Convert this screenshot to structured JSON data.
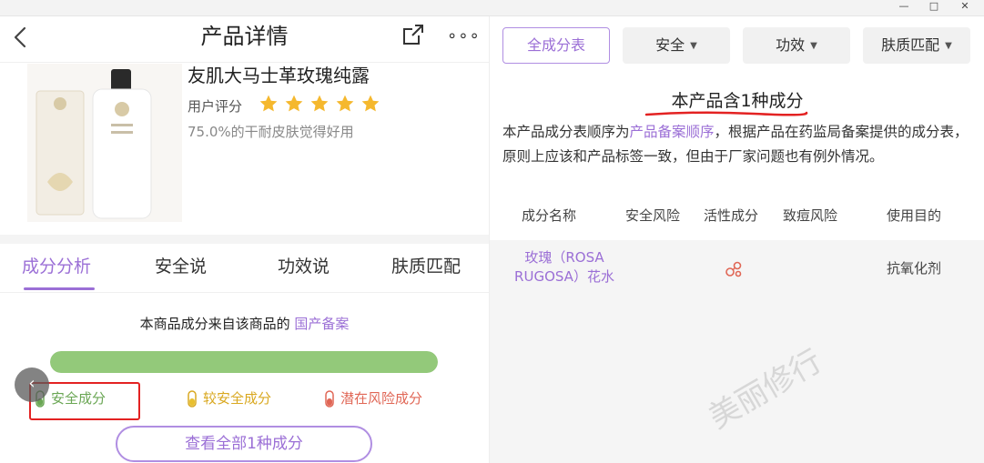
{
  "window": {
    "controls": [
      "minimize-icon",
      "maximize-icon",
      "close-icon"
    ],
    "minimize": "—",
    "maximize": "□",
    "close": "✕"
  },
  "header": {
    "title": "产品详情",
    "back_icon": "chevron-left-icon",
    "share_icon": "share-icon",
    "more": "∘∘∘"
  },
  "product": {
    "name": "友肌大马士革玫瑰纯露",
    "rating_label": "用户评分",
    "stars": 5,
    "star_color": "#f5b82e",
    "dry_skin_stat": "75.0%的干耐皮肤觉得好用"
  },
  "tabs": [
    {
      "label": "成分分析",
      "active": true
    },
    {
      "label": "安全说",
      "active": false
    },
    {
      "label": "功效说",
      "active": false
    },
    {
      "label": "肤质匹配",
      "active": false
    }
  ],
  "analysis": {
    "source_text": "本商品成分来自该商品的",
    "source_link": "国产备案",
    "safe_fraction": 1.0,
    "legend": [
      {
        "label": "安全成分",
        "color": "#6aa654",
        "icon": "green-tube-icon"
      },
      {
        "label": "较安全成分",
        "color": "#d9a820",
        "icon": "yellow-tube-icon"
      },
      {
        "label": "潜在风险成分",
        "color": "#e06655",
        "icon": "red-tube-icon"
      }
    ],
    "view_all_button": "查看全部1种成分"
  },
  "right_panel": {
    "filters": [
      {
        "label": "全成分表",
        "active": true,
        "dropdown": false
      },
      {
        "label": "安全",
        "active": false,
        "dropdown": true
      },
      {
        "label": "功效",
        "active": false,
        "dropdown": true
      },
      {
        "label": "肤质匹配",
        "active": false,
        "dropdown": true
      }
    ],
    "count_title": "本产品含1种成分",
    "desc_part1": "本产品成分表顺序为",
    "desc_link": "产品备案顺序",
    "desc_part2": "，根据产品在药监局备案提供的成分表，原则上应该和产品标签一致，但由于厂家问题也有例外情况。",
    "columns": [
      "成分名称",
      "安全风险",
      "活性成分",
      "致痘风险",
      "使用目的"
    ],
    "rows": [
      {
        "name_line1": "玫瑰（ROSA",
        "name_line2": "RUGOSA）花水",
        "active_icon": "active-ingredient-icon",
        "purpose": "抗氧化剂"
      }
    ],
    "watermark": "美丽修行"
  },
  "colors": {
    "accent": "#9b6fd6",
    "annotation_red": "#e32222",
    "bar_green": "#93c97a"
  }
}
